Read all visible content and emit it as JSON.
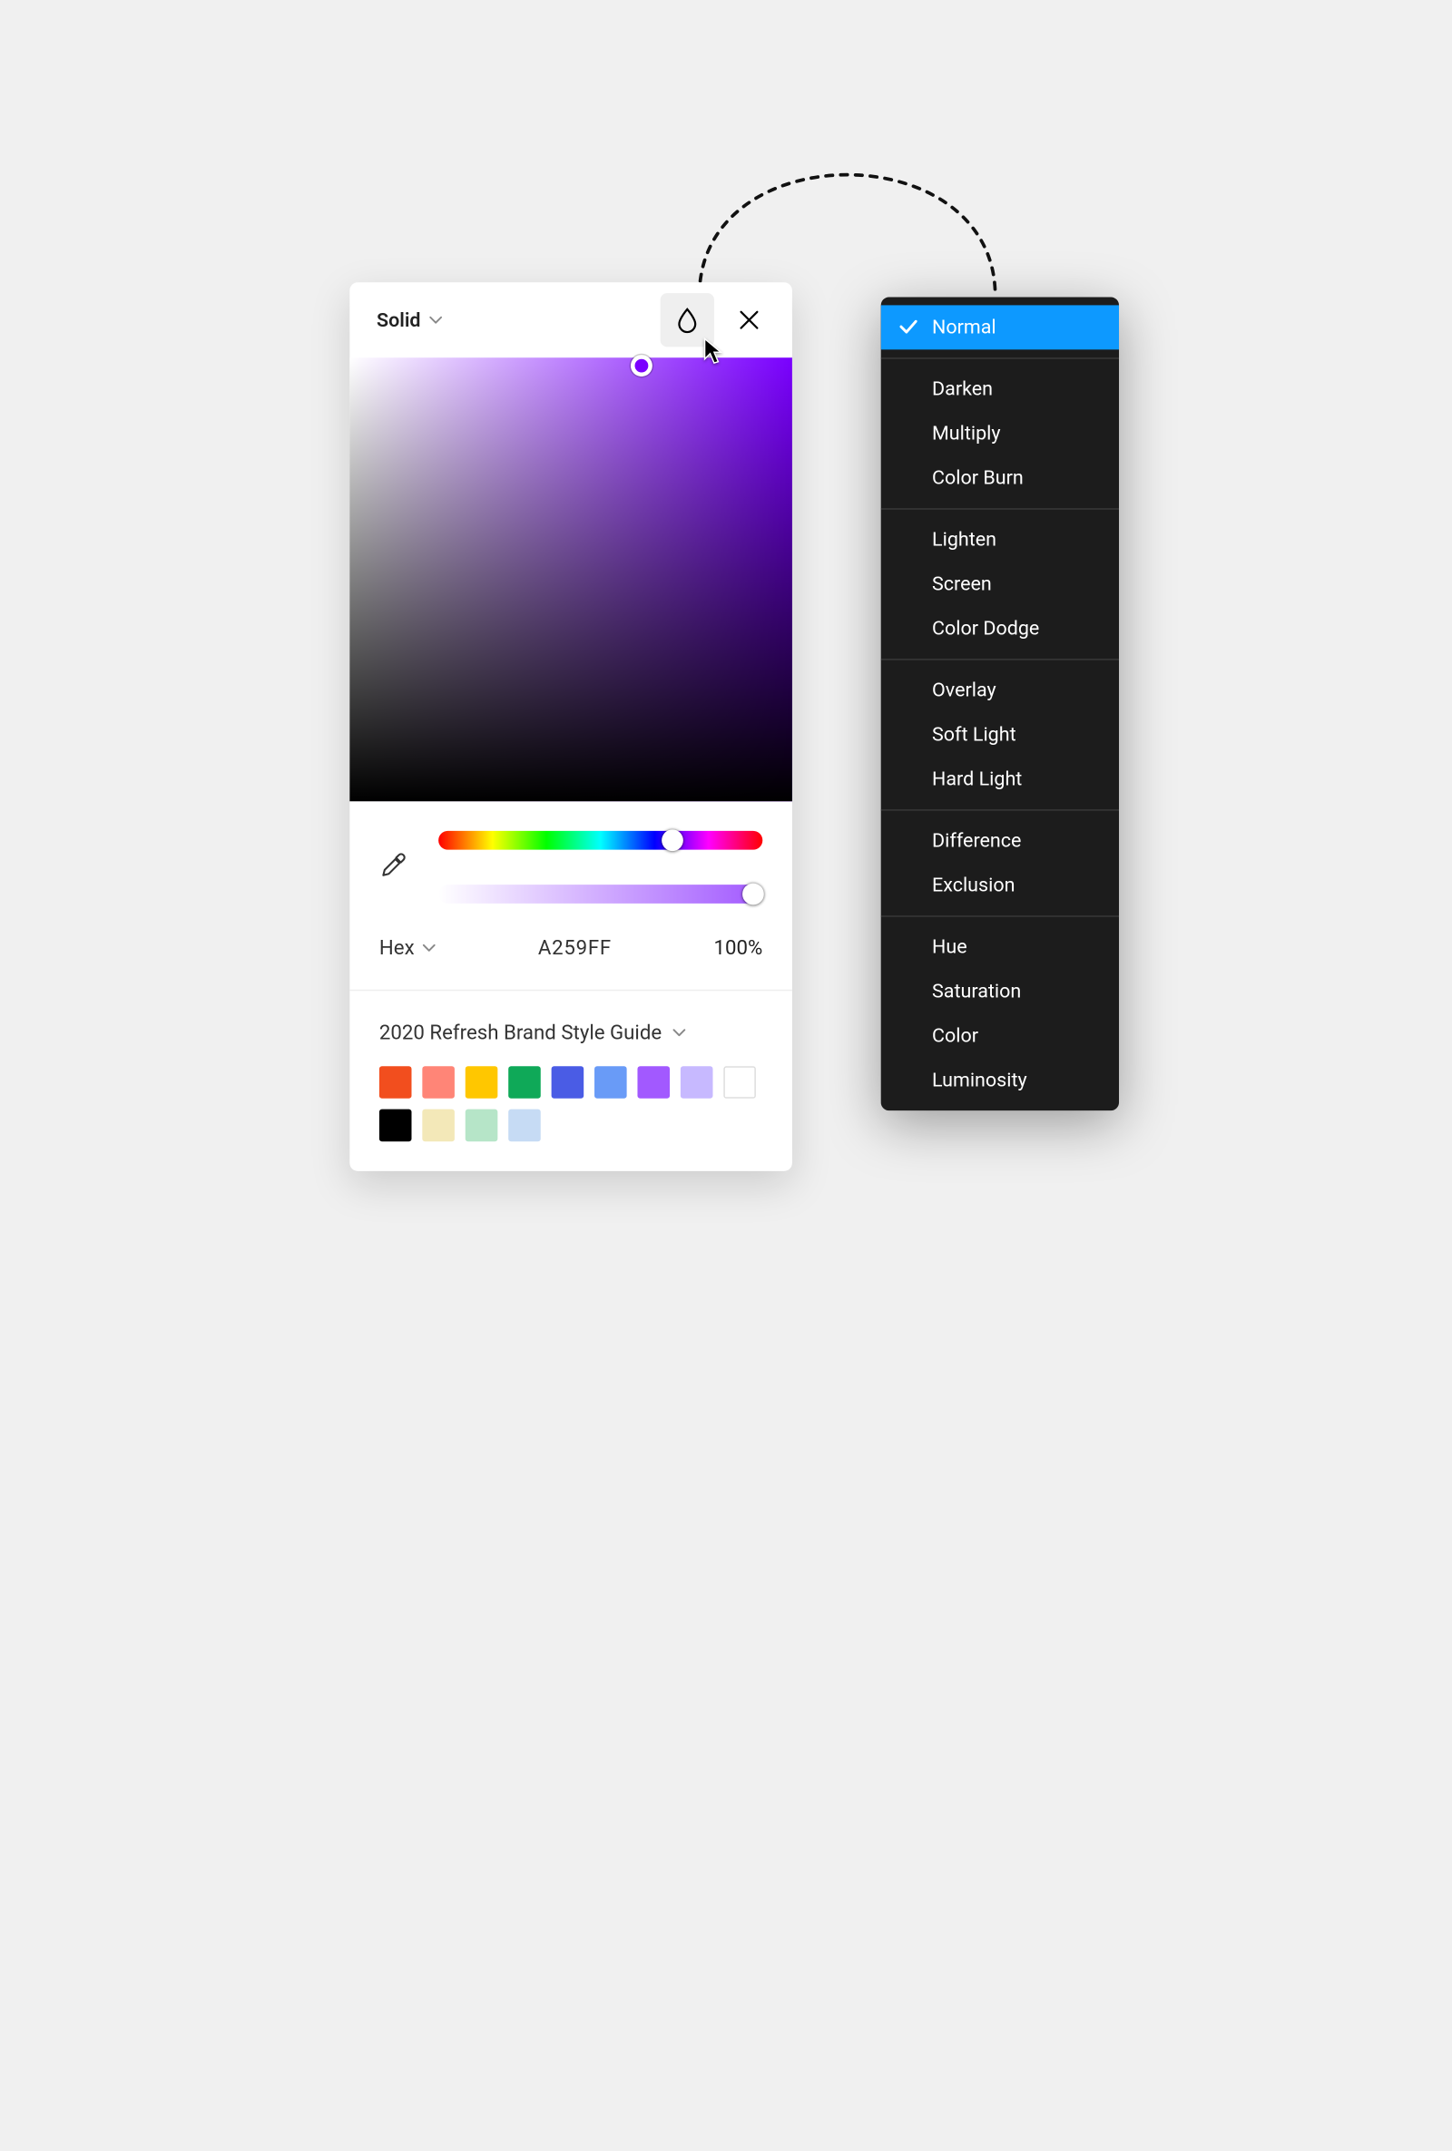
{
  "picker": {
    "fill_type": "Solid",
    "format_label": "Hex",
    "hex": "A259FF",
    "opacity": "100%",
    "library_name": "2020 Refresh Brand Style Guide",
    "swatches": [
      {
        "color": "#F24E1E",
        "border": false
      },
      {
        "color": "#FF8577",
        "border": false
      },
      {
        "color": "#FFC700",
        "border": false
      },
      {
        "color": "#0FA958",
        "border": false
      },
      {
        "color": "#4A5CE5",
        "border": false
      },
      {
        "color": "#699BF7",
        "border": false
      },
      {
        "color": "#A259FF",
        "border": false
      },
      {
        "color": "#C7B9FF",
        "border": false
      },
      {
        "color": "#FFFFFF",
        "border": true
      },
      {
        "color": "#000000",
        "border": false
      },
      {
        "color": "#F3E8B8",
        "border": false
      },
      {
        "color": "#B6E5C8",
        "border": false
      },
      {
        "color": "#C6DBF4",
        "border": false
      }
    ]
  },
  "blend_menu": {
    "selected": "Normal",
    "groups": [
      [
        "Normal"
      ],
      [
        "Darken",
        "Multiply",
        "Color Burn"
      ],
      [
        "Lighten",
        "Screen",
        "Color Dodge"
      ],
      [
        "Overlay",
        "Soft Light",
        "Hard Light"
      ],
      [
        "Difference",
        "Exclusion"
      ],
      [
        "Hue",
        "Saturation",
        "Color",
        "Luminosity"
      ]
    ]
  }
}
